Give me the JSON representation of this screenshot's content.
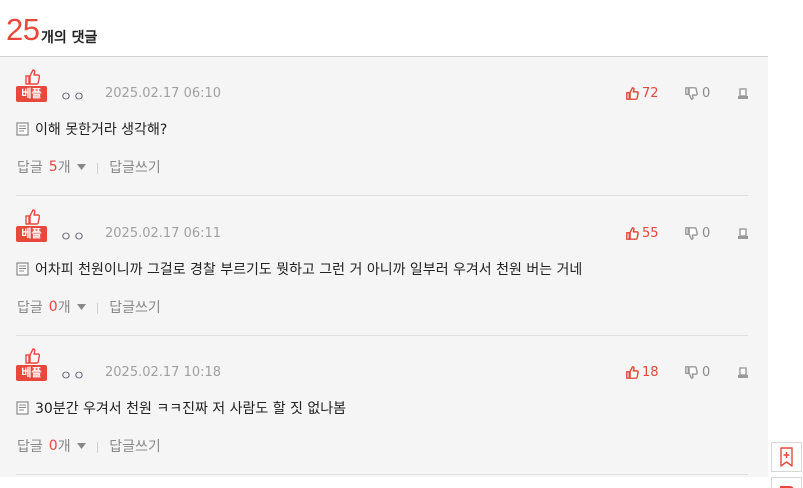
{
  "header": {
    "count": "25",
    "count_suffix": "개의 댓글"
  },
  "comments": [
    {
      "badge": "베플",
      "nickname": "ㅇㅇ",
      "date": "2025.02.17 06:10",
      "likes": "72",
      "dislikes": "0",
      "text": "이해 못한거라 생각해?",
      "reply_label": "답글",
      "reply_count": "5",
      "reply_unit": "개",
      "write_reply": "답글쓰기"
    },
    {
      "badge": "베플",
      "nickname": "ㅇㅇ",
      "date": "2025.02.17 06:11",
      "likes": "55",
      "dislikes": "0",
      "text": "어차피 천원이니까 그걸로 경찰 부르기도 뭣하고 그런 거 아니까 일부러 우겨서 천원 버는 거네",
      "reply_label": "답글",
      "reply_count": "0",
      "reply_unit": "개",
      "write_reply": "답글쓰기"
    },
    {
      "badge": "베플",
      "nickname": "ㅇㅇ",
      "date": "2025.02.17 10:18",
      "likes": "18",
      "dislikes": "0",
      "text": "30분간 우겨서 천원 ㅋㅋ진짜 저 사람도 할 짓 없나봄",
      "reply_label": "답글",
      "reply_count": "0",
      "reply_unit": "개",
      "write_reply": "답글쓰기"
    }
  ],
  "colors": {
    "accent": "#e8483b",
    "muted": "#a0a0a0",
    "panel": "#f5f5f5"
  },
  "icons": [
    "thumbs-up-icon",
    "thumbs-down-icon",
    "report-icon",
    "memo-icon",
    "caret-down-icon",
    "bookmark-icon"
  ]
}
